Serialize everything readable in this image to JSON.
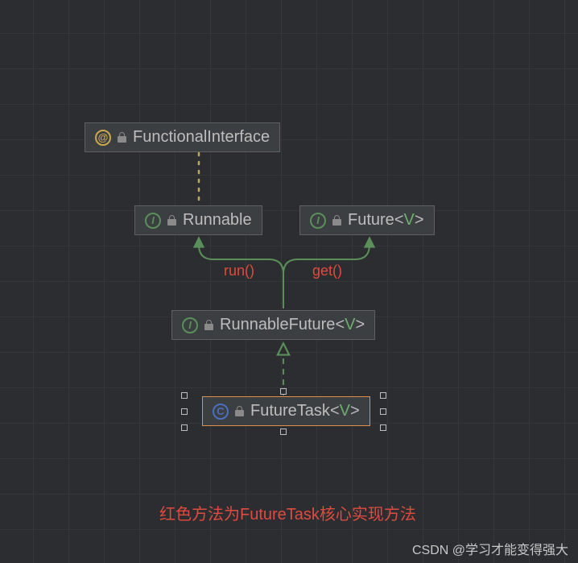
{
  "nodes": {
    "functionalInterface": {
      "badge": "@",
      "label": "FunctionalInterface"
    },
    "runnable": {
      "badge": "I",
      "label": "Runnable"
    },
    "future": {
      "badge": "I",
      "label": "Future",
      "generic": "V"
    },
    "runnableFuture": {
      "badge": "I",
      "label": "RunnableFuture",
      "generic": "V"
    },
    "futureTask": {
      "badge": "C",
      "label": "FutureTask",
      "generic": "V"
    }
  },
  "methods": {
    "run": "run()",
    "get": "get()"
  },
  "caption": "红色方法为FutureTask核心实现方法",
  "watermark": "CSDN @学习才能变得强大",
  "colors": {
    "edge_impl": "#5a8f5a",
    "edge_anno": "#c9a84f",
    "highlight": "#e04a3f",
    "select": "#e08f4a"
  }
}
